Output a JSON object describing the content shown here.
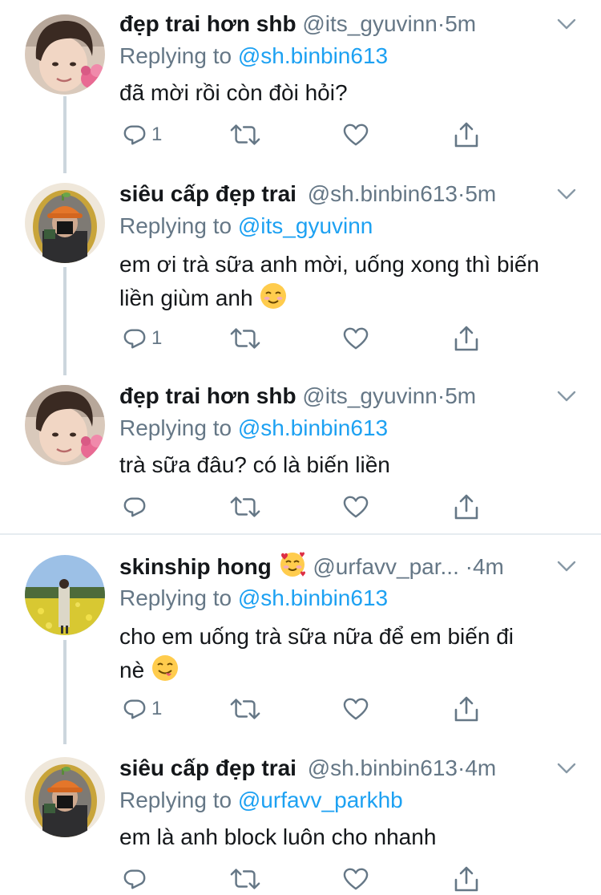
{
  "tweets": [
    {
      "name": "đẹp trai hơn shb",
      "handle": "@its_gyuvinn",
      "dot": "·",
      "time": "5m",
      "reply_prefix": "Replying to",
      "reply_to": "@sh.binbin613",
      "text": "đã mời rồi còn đòi hỏi?",
      "reply_count": "1"
    },
    {
      "name": "siêu cấp đẹp trai",
      "handle": "@sh.binbin613",
      "dot": "·",
      "time": "5m",
      "reply_prefix": "Replying to",
      "reply_to": "@its_gyuvinn",
      "text_line1": "em ơi trà sữa anh mời, uống xong thì biến",
      "text_line2": "liền giùm anh",
      "text_emoji": "relieved-smile-emoji",
      "reply_count": "1"
    },
    {
      "name": "đẹp trai hơn shb",
      "handle": "@its_gyuvinn",
      "dot": "·",
      "time": "5m",
      "reply_prefix": "Replying to",
      "reply_to": "@sh.binbin613",
      "text": "trà sữa đâu? có là biến liền",
      "reply_count": ""
    },
    {
      "name": "skinship hong",
      "name_emoji": "smiling-face-with-hearts-emoji",
      "handle": "@urfavv_par...",
      "dot": "·",
      "time": "4m",
      "reply_prefix": "Replying to",
      "reply_to": "@sh.binbin613",
      "text_line1": "cho em uống trà sữa nữa để em biến đi",
      "text_line2": "nè",
      "text_emoji": "yum-face-emoji",
      "reply_count": "1"
    },
    {
      "name": "siêu cấp đẹp trai",
      "handle": "@sh.binbin613",
      "dot": "·",
      "time": "4m",
      "reply_prefix": "Replying to",
      "reply_to": "@urfavv_parkhb",
      "text": "em là anh block luôn cho nhanh",
      "reply_count": ""
    }
  ],
  "icons": [
    "reply-icon",
    "retweet-icon",
    "like-icon",
    "share-icon",
    "chevron-down-icon"
  ],
  "colors": {
    "name": "#14171a",
    "secondary": "#657786",
    "mention": "#1da1f2",
    "thread_line": "#ccd6dd",
    "divider": "#e6ecf0"
  }
}
